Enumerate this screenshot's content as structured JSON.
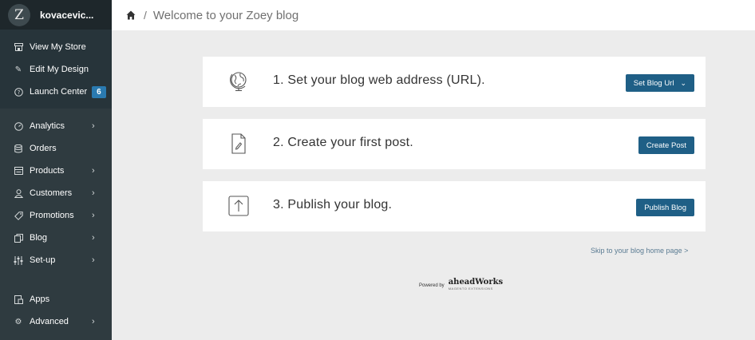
{
  "brand": {
    "logo_letter": "Z",
    "store_name": "kovacevic..."
  },
  "sidebar": {
    "top_items": [
      {
        "label": "View My Store",
        "icon": "store-icon"
      },
      {
        "label": "Edit My Design",
        "icon": "pencil-icon"
      },
      {
        "label": "Launch Center",
        "icon": "question-icon",
        "badge": "6"
      }
    ],
    "main_items": [
      {
        "label": "Analytics",
        "icon": "gauge-icon",
        "chevron": true
      },
      {
        "label": "Orders",
        "icon": "database-icon",
        "chevron": false
      },
      {
        "label": "Products",
        "icon": "list-icon",
        "chevron": true
      },
      {
        "label": "Customers",
        "icon": "users-icon",
        "chevron": true
      },
      {
        "label": "Promotions",
        "icon": "tag-icon",
        "chevron": true
      },
      {
        "label": "Blog",
        "icon": "copy-icon",
        "chevron": true
      },
      {
        "label": "Set-up",
        "icon": "sliders-icon",
        "chevron": true
      }
    ],
    "bottom_items": [
      {
        "label": "Apps",
        "icon": "apps-icon",
        "chevron": false
      },
      {
        "label": "Advanced",
        "icon": "gear-icon",
        "chevron": true
      }
    ]
  },
  "header": {
    "separator": "/",
    "title": "Welcome to your Zoey blog"
  },
  "steps": [
    {
      "text": "1. Set your blog web address (URL).",
      "button": "Set Blog Url",
      "icon": "globe-icon",
      "dropdown": "⌄"
    },
    {
      "text": "2. Create your first post.",
      "button": "Create Post",
      "icon": "document-edit-icon"
    },
    {
      "text": "3. Publish your blog.",
      "button": "Publish Blog",
      "icon": "upload-icon"
    }
  ],
  "skip_link": "Skip to your blog home page >",
  "footer": {
    "powered_by": "Powered by",
    "brand": "aheadWorks",
    "tagline": "MAGENTO EXTENSIONS"
  },
  "colors": {
    "sidebar": "#2f3b40",
    "accent": "#1f5f86",
    "badge": "#2a7ab0"
  }
}
